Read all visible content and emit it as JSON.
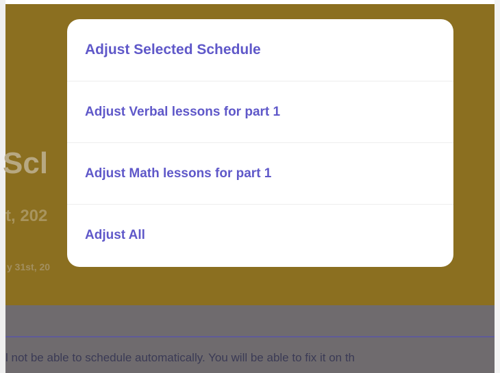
{
  "background": {
    "title_fragment": "Scl",
    "subtitle_fragment": "t, 202",
    "date_fragment": "y 31st, 20",
    "notice_text": "l not be able to schedule automatically. You will be able to fix it on th"
  },
  "menu": {
    "items": [
      {
        "label": "Adjust Selected Schedule"
      },
      {
        "label": "Adjust Verbal lessons for part 1"
      },
      {
        "label": "Adjust Math lessons for part 1"
      },
      {
        "label": "Adjust All"
      }
    ]
  },
  "colors": {
    "header_band": "#8b6f20",
    "menu_text": "#5f58c9",
    "overlay_gray": "#6f6b6e"
  }
}
